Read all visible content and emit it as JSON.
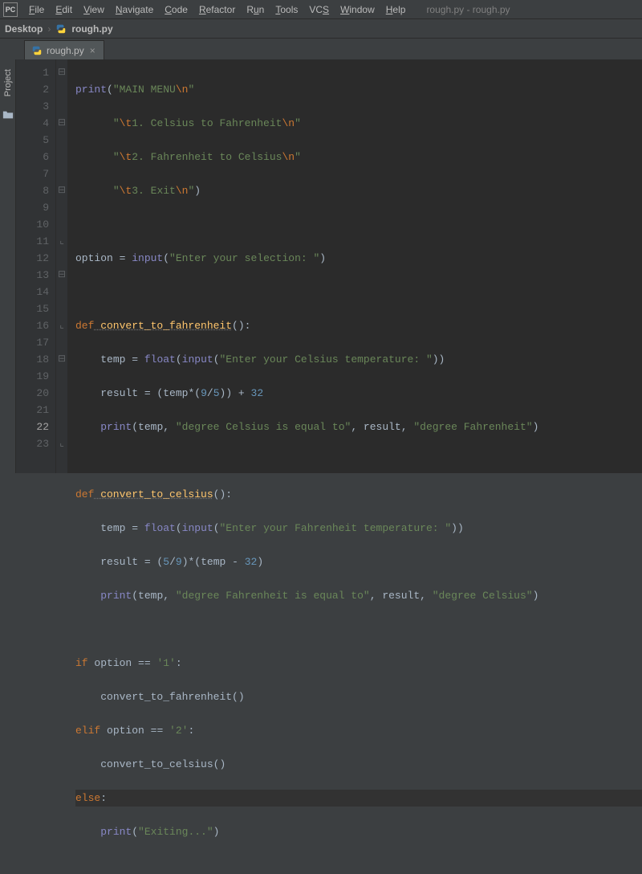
{
  "menubar": {
    "logo": "PC",
    "items": [
      {
        "mn": "F",
        "rest": "ile"
      },
      {
        "mn": "E",
        "rest": "dit"
      },
      {
        "mn": "V",
        "rest": "iew"
      },
      {
        "mn": "N",
        "rest": "avigate"
      },
      {
        "mn": "C",
        "rest": "ode"
      },
      {
        "mn": "R",
        "rest": "efactor"
      },
      {
        "mn": "R",
        "rest": "un",
        "mnpos": 0,
        "full": "Run",
        "u": "u"
      },
      {
        "mn": "T",
        "rest": "ools"
      },
      {
        "mn": "V",
        "rest": "CS",
        "full": "VCS",
        "literal": true,
        "u": "S",
        "pre": "VC"
      },
      {
        "mn": "W",
        "rest": "indow"
      },
      {
        "mn": "H",
        "rest": "elp"
      }
    ],
    "title": "rough.py - rough.py"
  },
  "breadcrumb": {
    "root": "Desktop",
    "sep": "›",
    "file": "rough.py"
  },
  "tab": {
    "file": "rough.py",
    "close": "×"
  },
  "toolwindows": {
    "project": "Project"
  },
  "editor": {
    "caret_line": 22,
    "lines_count": 23
  },
  "code": {
    "l1": {
      "call": "print",
      "s1": "\"MAIN MENU",
      "esc": "\\n",
      "s2": "\""
    },
    "l2": {
      "s1": "\"",
      "esc1": "\\t",
      "s2": "1. Celsius to Fahrenheit",
      "esc2": "\\n",
      "s3": "\""
    },
    "l3": {
      "s1": "\"",
      "esc1": "\\t",
      "s2": "2. Fahrenheit to Celsius",
      "esc2": "\\n",
      "s3": "\""
    },
    "l4": {
      "s1": "\"",
      "esc1": "\\t",
      "s2": "3. Exit",
      "esc2": "\\n",
      "s3": "\"",
      "p": ")"
    },
    "l6": {
      "id": "option",
      "op": " = ",
      "call": "input",
      "s": "\"Enter your selection: \"",
      "p": ")"
    },
    "l8": {
      "kw": "def",
      "fn": " convert_to_fahrenheit",
      "sig": "():"
    },
    "l9": {
      "id": "temp",
      "op": " = ",
      "call1": "float",
      "call2": "input",
      "s": "\"Enter your Celsius temperature: \"",
      "p": "))"
    },
    "l10": {
      "id": "result",
      "op": " = (",
      "id2": "temp",
      "op2": "*(",
      "n1": "9",
      "op3": "/",
      "n2": "5",
      "op4": ")) + ",
      "n3": "32"
    },
    "l11": {
      "call": "print",
      "id1": "temp",
      "c1": ", ",
      "s1": "\"degree Celsius is equal to\"",
      "c2": ", ",
      "id2": "result",
      "c3": ", ",
      "s2": "\"degree Fahrenheit\"",
      "p": ")"
    },
    "l13": {
      "kw": "def",
      "fn": " convert_to_celsius",
      "sig": "():"
    },
    "l14": {
      "id": "temp",
      "op": " = ",
      "call1": "float",
      "call2": "input",
      "s": "\"Enter your Fahrenheit temperature: \"",
      "p": "))"
    },
    "l15": {
      "id": "result",
      "op": " = (",
      "n1": "5",
      "op2": "/",
      "n2": "9",
      "op3": ")*(",
      "id2": "temp",
      "op4": " - ",
      "n3": "32",
      "op5": ")"
    },
    "l16": {
      "call": "print",
      "id1": "temp",
      "c1": ", ",
      "s1": "\"degree Fahrenheit is equal to\"",
      "c2": ", ",
      "id2": "result",
      "c3": ", ",
      "s2": "\"degree Celsius\"",
      "p": ")"
    },
    "l18": {
      "kw": "if",
      "id": " option ",
      "op": "== ",
      "s": "'1'",
      "c": ":"
    },
    "l19": {
      "fn": "convert_to_fahrenheit",
      "p": "()"
    },
    "l20": {
      "kw": "elif",
      "id": " option ",
      "op": "== ",
      "s": "'2'",
      "c": ":"
    },
    "l21": {
      "fn": "convert_to_celsius",
      "p": "()"
    },
    "l22": {
      "kw": "else",
      "c": ":"
    },
    "l23": {
      "call": "print",
      "s": "\"Exiting...\"",
      "p": ")"
    }
  }
}
